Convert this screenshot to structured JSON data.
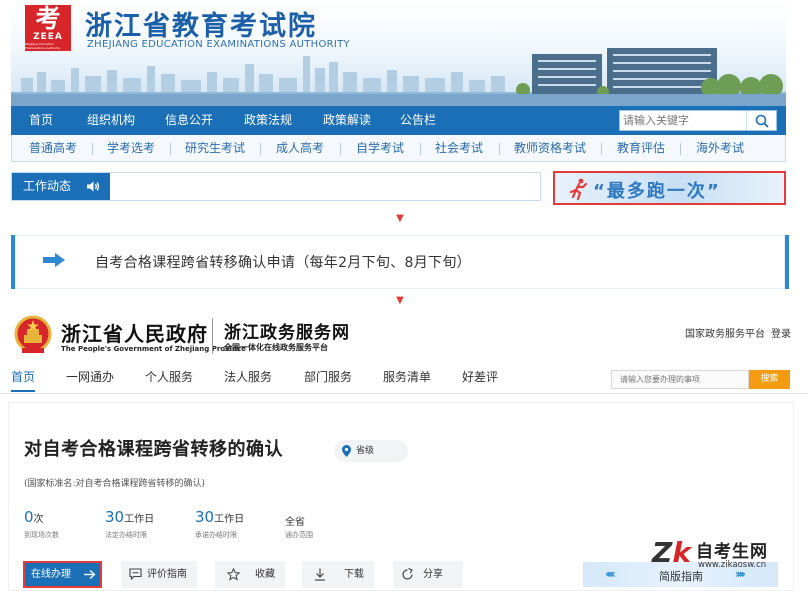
{
  "exam_site": {
    "title": "浙江省教育考试院",
    "subtitle": "ZHEJIANG EDUCATION EXAMINATIONS AUTHORITY",
    "logo_glyph": "考",
    "logo_text": "ZEEA",
    "logo_subtext": "Zhejiang Education Examinations Authority",
    "nav": [
      "首页",
      "组织机构",
      "信息公开",
      "政策法规",
      "政策解读",
      "公告栏"
    ],
    "search_placeholder": "请输入关键字",
    "subnav": [
      "普通高考",
      "学考选考",
      "研究生考试",
      "成人高考",
      "自学考试",
      "社会考试",
      "教师资格考试",
      "教育评估",
      "海外考试"
    ],
    "notice_label": "工作动态",
    "pao_slogan": "“最多跑一次”",
    "step_text": "自考合格课程跨省转移确认申请（每年2月下旬、8月下旬）",
    "colors": {
      "primary": "#1b6fb6",
      "highlight": "#e23b3b"
    }
  },
  "gov_site": {
    "gov_name": "浙江省人民政府",
    "gov_name_en": "The People's Government of Zhejiang Province",
    "service_name": "浙江政务服务网",
    "service_sub": "全国一体化在线政务服务平台",
    "top_links": [
      "国家政务服务平台",
      "登录"
    ],
    "nav": [
      "首页",
      "一网通办",
      "个人服务",
      "法人服务",
      "部门服务",
      "服务清单",
      "好差评"
    ],
    "search_placeholder": "请输入您要办理的事项",
    "search_button": "搜索",
    "matter": {
      "title": "对自考合格课程跨省转移的确认",
      "level": "省级",
      "standard_name": "(国家标准名:对自考合格课程跨省转移的确认)",
      "stats": [
        {
          "value": "0",
          "unit": "次",
          "label": "到现场次数"
        },
        {
          "value": "30",
          "unit": "工作日",
          "label": "法定办结时限"
        },
        {
          "value": "30",
          "unit": "工作日",
          "label": "承诺办结时限"
        },
        {
          "text": "全省",
          "label": "通办范围"
        }
      ],
      "buttons": {
        "online": "在线办理",
        "guide": "评价指南",
        "favorite": "收藏",
        "download": "下载",
        "share": "分享",
        "simple_guide": "简版指南"
      }
    }
  },
  "watermark": {
    "logo": [
      "Z",
      "k"
    ],
    "name": "自考生网",
    "url": "www.zikaosw.cn"
  }
}
